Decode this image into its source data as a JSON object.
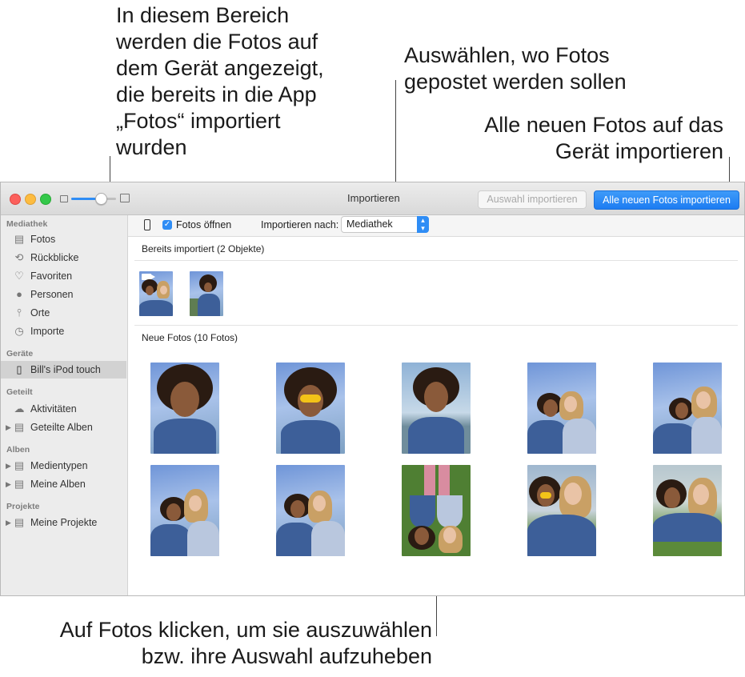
{
  "callouts": {
    "top_left": "In diesem Bereich werden die Fotos auf dem Gerät angezeigt, die bereits in die App „Fotos“ importiert wurden",
    "top_middle": "Auswählen, wo Fotos gepostet werden sollen",
    "top_right": "Alle neuen Fotos auf das Gerät importieren",
    "bottom": "Auf Fotos klicken, um sie auszuwählen bzw. ihre Auswahl aufzuheben"
  },
  "window": {
    "title": "Importieren",
    "import_selected_label": "Auswahl importieren",
    "import_all_label": "Alle neuen Fotos importieren",
    "zoom_level": 0.55
  },
  "sidebar": {
    "sections": [
      {
        "heading": "Mediathek",
        "items": [
          {
            "label": "Fotos",
            "icon": "photos-icon"
          },
          {
            "label": "Rückblicke",
            "icon": "memories-icon"
          },
          {
            "label": "Favoriten",
            "icon": "heart-icon"
          },
          {
            "label": "Personen",
            "icon": "person-icon"
          },
          {
            "label": "Orte",
            "icon": "pin-icon"
          },
          {
            "label": "Importe",
            "icon": "clock-icon"
          }
        ]
      },
      {
        "heading": "Geräte",
        "items": [
          {
            "label": "Bill's iPod touch",
            "icon": "ipod-icon",
            "selected": true
          }
        ]
      },
      {
        "heading": "Geteilt",
        "items": [
          {
            "label": "Aktivitäten",
            "icon": "cloud-icon"
          },
          {
            "label": "Geteilte Alben",
            "icon": "folder-icon"
          }
        ]
      },
      {
        "heading": "Alben",
        "items": [
          {
            "label": "Medientypen",
            "icon": "folder-icon"
          },
          {
            "label": "Meine Alben",
            "icon": "folder-icon"
          }
        ]
      },
      {
        "heading": "Projekte",
        "items": [
          {
            "label": "Meine Projekte",
            "icon": "folder-icon"
          }
        ]
      }
    ]
  },
  "toolbar": {
    "open_photos_label": "Fotos öffnen",
    "open_photos_checked": true,
    "import_to_label": "Importieren nach:",
    "import_to_value": "Mediathek"
  },
  "already_imported": {
    "title": "Bereits importiert (2 Objekte)"
  },
  "new_photos": {
    "title": "Neue Fotos (10 Fotos)"
  },
  "colors": {
    "accent": "#2f8df5",
    "close": "#fc605c",
    "minimize": "#fdbc40",
    "zoom": "#34c84a"
  }
}
